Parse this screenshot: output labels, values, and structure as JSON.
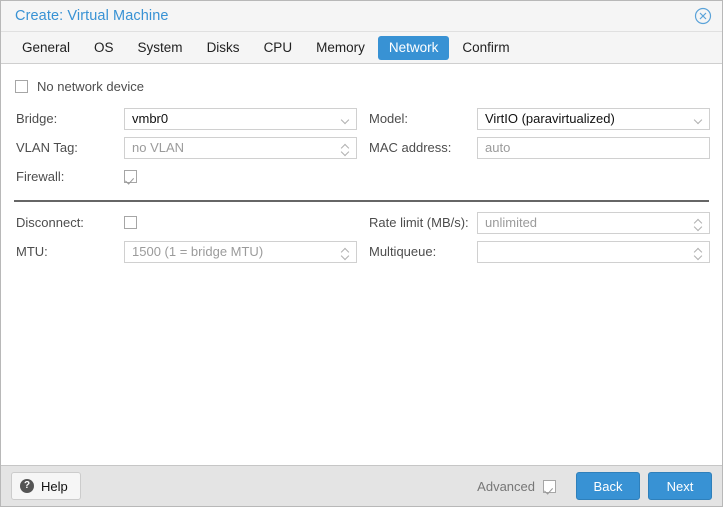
{
  "window": {
    "title": "Create: Virtual Machine",
    "close_icon": "close-circle-icon"
  },
  "tabs": [
    {
      "label": "General",
      "active": false
    },
    {
      "label": "OS",
      "active": false
    },
    {
      "label": "System",
      "active": false
    },
    {
      "label": "Disks",
      "active": false
    },
    {
      "label": "CPU",
      "active": false
    },
    {
      "label": "Memory",
      "active": false
    },
    {
      "label": "Network",
      "active": true
    },
    {
      "label": "Confirm",
      "active": false
    }
  ],
  "form": {
    "no_network_device": {
      "label": "No network device",
      "checked": false
    },
    "left": {
      "bridge": {
        "label": "Bridge:",
        "value": "vmbr0",
        "is_placeholder": false,
        "control": "dropdown"
      },
      "vlan_tag": {
        "label": "VLAN Tag:",
        "value": "no VLAN",
        "is_placeholder": true,
        "control": "spinner"
      },
      "firewall": {
        "label": "Firewall:",
        "checked": true,
        "control": "checkbox"
      },
      "disconnect": {
        "label": "Disconnect:",
        "checked": false,
        "control": "checkbox"
      },
      "mtu": {
        "label": "MTU:",
        "value": "1500 (1 = bridge MTU)",
        "is_placeholder": true,
        "control": "spinner"
      }
    },
    "right": {
      "model": {
        "label": "Model:",
        "value": "VirtIO (paravirtualized)",
        "is_placeholder": false,
        "control": "dropdown"
      },
      "mac_address": {
        "label": "MAC address:",
        "value": "auto",
        "is_placeholder": true,
        "control": "text"
      },
      "rate_limit": {
        "label": "Rate limit (MB/s):",
        "value": "unlimited",
        "is_placeholder": true,
        "control": "spinner"
      },
      "multiqueue": {
        "label": "Multiqueue:",
        "value": "",
        "is_placeholder": true,
        "control": "spinner"
      }
    }
  },
  "footer": {
    "help_label": "Help",
    "help_icon": "question-mark-icon",
    "advanced_label": "Advanced",
    "advanced_checked": true,
    "back_label": "Back",
    "next_label": "Next"
  },
  "colors": {
    "accent": "#3892d4",
    "header_bg": "#f5f5f5",
    "footer_bg": "#e4e4e4",
    "placeholder_text": "#9b9b9b"
  }
}
